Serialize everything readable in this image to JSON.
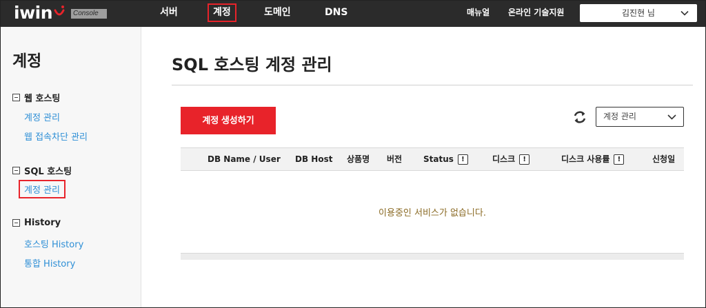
{
  "brand": {
    "logo": "iwin",
    "badge": "Console"
  },
  "nav": {
    "items": [
      {
        "label": "서버"
      },
      {
        "label": "계정"
      },
      {
        "label": "도메인"
      },
      {
        "label": "DNS"
      }
    ]
  },
  "util": {
    "manual": "매뉴얼",
    "support": "온라인 기술지원",
    "user": "김진현 님"
  },
  "sidebar": {
    "title": "계정",
    "groups": [
      {
        "label": "웹 호스팅",
        "links": [
          "계정 관리",
          "웹 접속차단 관리"
        ]
      },
      {
        "label": "SQL 호스팅",
        "links": [
          "계정 관리"
        ]
      },
      {
        "label": "History",
        "links": [
          "호스팅 History",
          "통합 History"
        ]
      }
    ]
  },
  "main": {
    "title": "SQL 호스팅 계정 관리",
    "create_label": "계정 생성하기",
    "filter_value": "계정 관리",
    "columns": [
      "DB Name / User",
      "DB Host",
      "상품명",
      "버전",
      "Status",
      "디스크",
      "디스크 사용률",
      "신청일"
    ],
    "info_mark": "!",
    "empty_message": "이용중인 서비스가 없습니다."
  },
  "colors": {
    "accent": "#e8232a",
    "link": "#2e8fd6",
    "topbar": "#2b2b2b"
  },
  "icons": [
    "smile-logo-icon",
    "chevron-down-icon",
    "refresh-icon",
    "minus-box-icon",
    "info-icon"
  ]
}
